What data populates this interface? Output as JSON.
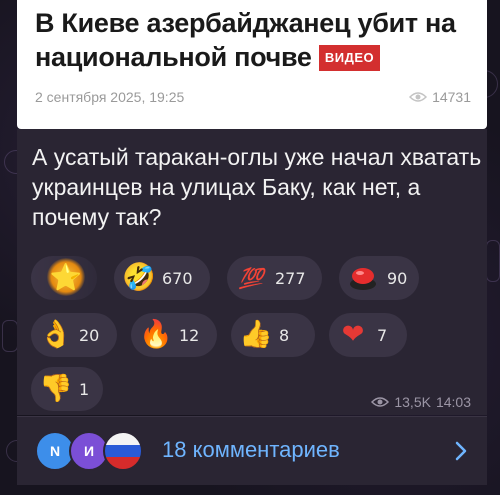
{
  "preview": {
    "title": "В Киеве азербайджанец убит на национальной почве",
    "badge": "ВИДЕО",
    "date": "2 сентября 2025, 19:25",
    "views": "14731"
  },
  "message": {
    "text": "А усатый таракан-оглы уже начал хватать украинцев на улицах Баку, как нет, а почему так?",
    "views": "13,5K",
    "time": "14:03"
  },
  "reactions": [
    {
      "icon": "star-icon",
      "emoji": "⭐",
      "count": ""
    },
    {
      "icon": "rofl-icon",
      "emoji": "🤣",
      "count": "670"
    },
    {
      "icon": "hundred-icon",
      "emoji": "💯",
      "count": "277"
    },
    {
      "icon": "red-button-icon",
      "emoji": "🔴",
      "count": "90"
    },
    {
      "icon": "ok-hand-icon",
      "emoji": "👌",
      "count": "20"
    },
    {
      "icon": "fire-icon",
      "emoji": "🔥",
      "count": "12"
    },
    {
      "icon": "thumbs-up-icon",
      "emoji": "👍",
      "count": "8"
    },
    {
      "icon": "heart-icon",
      "emoji": "❤",
      "count": "7"
    },
    {
      "icon": "thumbs-down-icon",
      "emoji": "👎",
      "count": "1"
    }
  ],
  "comments": {
    "label": "18 комментариев",
    "avatars": [
      "N",
      "И"
    ]
  }
}
